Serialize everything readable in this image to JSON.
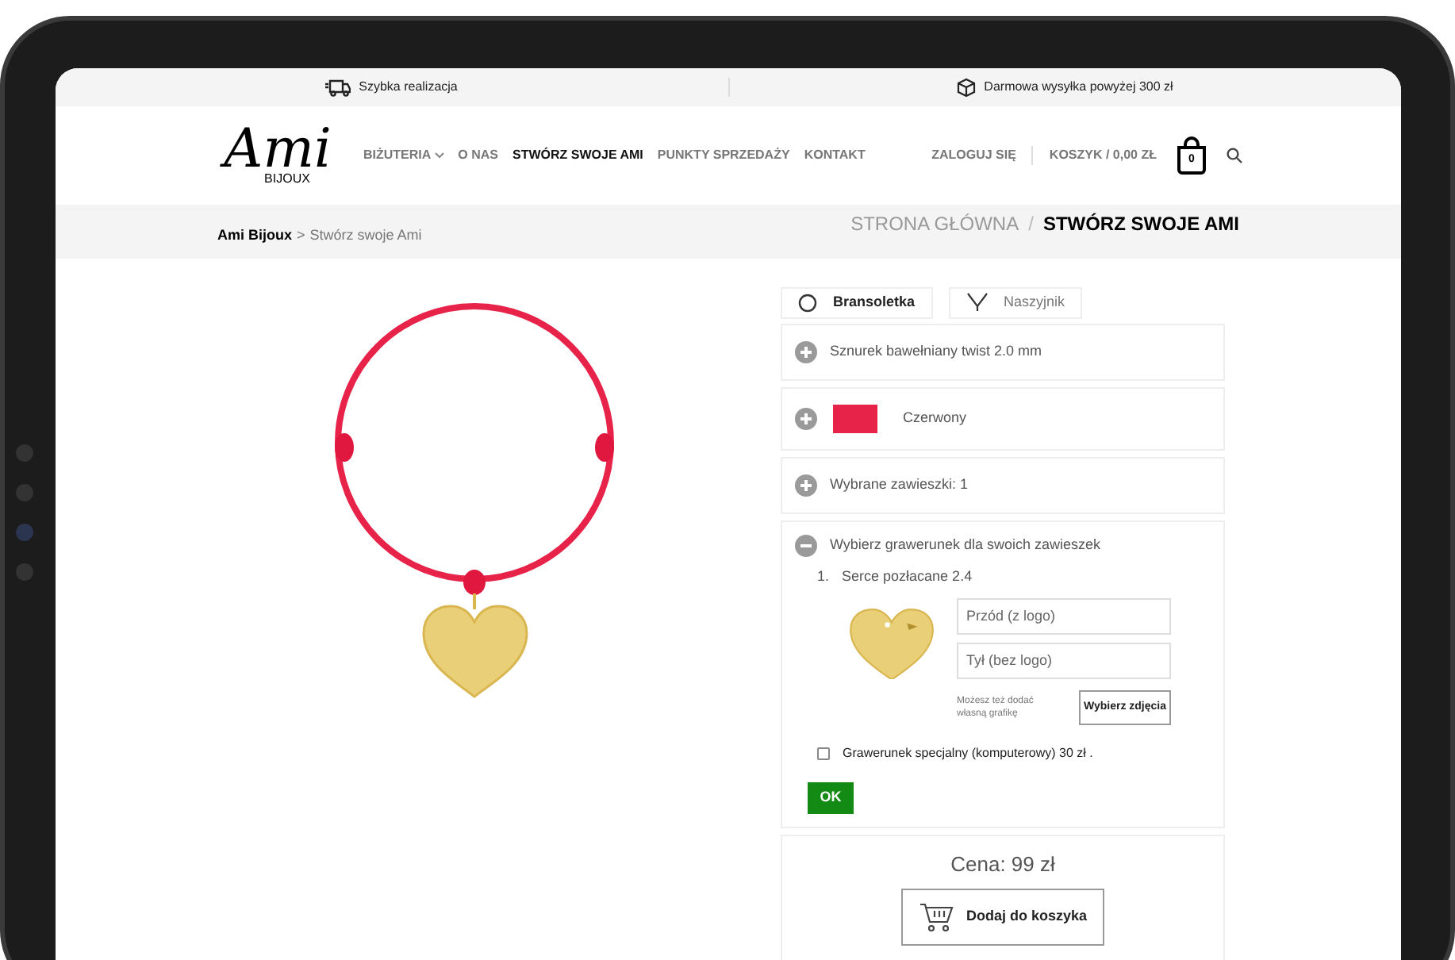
{
  "top_bar": {
    "items": [
      {
        "kind": "fast",
        "text": "Szybka realizacja"
      },
      {
        "kind": "shipping",
        "text": "Darmowa wysyłka powyżej 300 zł"
      }
    ]
  },
  "logo": {
    "script": "Ami",
    "sub": "BIJOUX"
  },
  "nav": [
    {
      "label": "BIŻUTERIA",
      "dropdown": true,
      "selected": false
    },
    {
      "label": "O NAS",
      "dropdown": false,
      "selected": false
    },
    {
      "label": "STWÓRZ SWOJE AMI",
      "dropdown": false,
      "selected": true
    },
    {
      "label": "PUNKTY SPRZEDAŻY",
      "dropdown": false,
      "selected": false
    },
    {
      "label": "KONTAKT",
      "dropdown": false,
      "selected": false
    }
  ],
  "account": {
    "login": "ZALOGUJ SIĘ",
    "cart": "KOSZYK / 0,00 ZŁ",
    "cart_count": "0"
  },
  "breadcrumb_left": {
    "home": "Ami Bijoux",
    "separator": ">",
    "current": "Stwórz swoje Ami"
  },
  "page_title": {
    "home": "STRONA GŁÓWNA",
    "separator": "/",
    "current": "STWÓRZ SWOJE AMI"
  },
  "type_tabs": [
    {
      "kind": "bracelet",
      "label": "Bransoletka",
      "selected": true
    },
    {
      "kind": "necklace",
      "label": "Naszyjnik",
      "selected": false
    }
  ],
  "sections": [
    {
      "label": "Sznurek bawełniany twist 2.0 mm",
      "expanded": false
    },
    {
      "label": "Czerwony",
      "expanded": false,
      "color": "#e8234a"
    },
    {
      "label": "Wybrane zawieszki: 1",
      "expanded": false
    },
    {
      "label": "Wybierz grawerunek dla swoich zawieszek",
      "expanded": true
    }
  ],
  "engraving": {
    "number": "1.",
    "charm": "Serce pozłacane 2.4",
    "front_placeholder": "Przód (z logo)",
    "back_placeholder": "Tył (bez logo)",
    "hint": "Możesz też dodać własną grafikę",
    "choose_button": "Wybierz zdjęcia",
    "special": {
      "label": "Grawerunek specjalny (komputerowy) 30 zł .",
      "checked": false
    },
    "ok_button": "OK"
  },
  "price": {
    "text": "Cena: 99 zł",
    "button": "Dodaj do koszyka"
  }
}
